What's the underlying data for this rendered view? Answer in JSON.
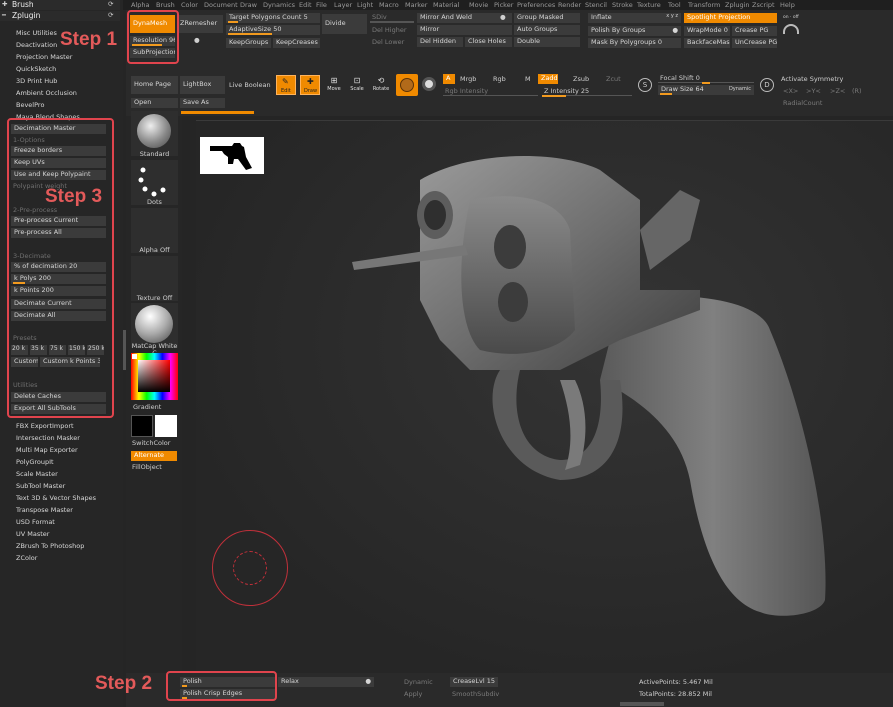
{
  "menu": [
    "Alpha",
    "Brush",
    "Color",
    "Document",
    "Draw",
    "Dynamics",
    "Edit",
    "File",
    "Layer",
    "Light",
    "Macro",
    "Marker",
    "Material",
    "Movie",
    "Picker",
    "Preferences",
    "Render",
    "Stencil",
    "Stroke",
    "Texture",
    "Tool",
    "Transform",
    "Zplugin",
    "Zscript",
    "Help"
  ],
  "left_panel": {
    "brush_title": "Brush",
    "zplugin_title": "Zplugin",
    "items_top": [
      "Misc Utilities",
      "Deactivation",
      "Projection Master",
      "QuickSketch",
      "3D Print Hub",
      "Ambient Occlusion",
      "BevelPro",
      "Maya Blend Shapes"
    ],
    "decimation": {
      "title": "Decimation Master",
      "options_header": "1-Options",
      "freeze": "Freeze borders",
      "keep_uvs": "Keep UVs",
      "use_keep_polypaint": "Use and Keep Polypaint",
      "polypaint_weight": "Polypaint weight",
      "preprocess_header": "2-Pre-process",
      "preprocess_current": "Pre-process Current",
      "preprocess_all": "Pre-process All",
      "decimate_header": "3-Decimate",
      "pct_label": "% of decimation",
      "pct_value": "20",
      "kpolys_label": "k Polys",
      "kpolys_value": "200",
      "kpoints_label": "k Points",
      "kpoints_value": "200",
      "decimate_current": "Decimate Current",
      "decimate_all": "Decimate All",
      "presets_header": "Presets",
      "presets": [
        "20 k",
        "35 k",
        "75 k",
        "150 k",
        "250 k"
      ],
      "custom": "Custom",
      "custom_k_label": "Custom k Points",
      "custom_k_value": "30",
      "utilities_header": "Utilities",
      "delete_caches": "Delete Caches",
      "export_all": "Export All SubTools"
    },
    "items_bottom": [
      "FBX ExportImport",
      "Intersection Masker",
      "Multi Map Exporter",
      "PolyGroupIt",
      "Scale Master",
      "SubTool Master",
      "Text 3D & Vector Shapes",
      "Transpose Master",
      "USD Format",
      "UV Master",
      "ZBrush To Photoshop",
      "ZColor"
    ]
  },
  "top": {
    "dynamesh": "DynaMesh",
    "resolution_label": "Resolution",
    "resolution_value": "968",
    "subprojection_label": "SubProjection",
    "subprojection_value": "0",
    "zremesher": "ZRemesher",
    "target_polys_label": "Target Polygons Count",
    "target_polys_value": "5",
    "adaptive_label": "AdaptiveSize",
    "adaptive_value": "50",
    "keepgroups": "KeepGroups",
    "keepcreases": "KeepCreases",
    "divide": "Divide",
    "sdiv": "SDiv",
    "del_higher": "Del Higher",
    "del_lower": "Del Lower",
    "mirror_weld": "Mirror And Weld",
    "mirror": "Mirror",
    "del_hidden": "Del Hidden",
    "close_holes": "Close Holes",
    "group_masked": "Group Masked",
    "auto_groups": "Auto Groups",
    "double": "Double",
    "inflate": "Inflate",
    "xyz": "x y z",
    "polish_groups": "Polish By Groups",
    "mask_polygroups_label": "Mask By Polygroups",
    "mask_polygroups_value": "0",
    "spotlight": "Spotlight Projection",
    "wrapmode_label": "WrapMode",
    "wrapmode_value": "0",
    "crease_pg": "Crease PG",
    "backface": "BackfaceMask",
    "uncrease_pg": "UnCrease PG",
    "rot_label": "on · off"
  },
  "shelf": {
    "home": "Home Page",
    "lightbox": "LightBox",
    "live_boolean": "Live Boolean",
    "open": "Open",
    "save_as": "Save As",
    "edit": "Edit",
    "draw": "Draw",
    "move": "Move",
    "scale": "Scale",
    "rotate": "Rotate",
    "a": "A",
    "mrgb": "Mrgb",
    "rgb": "Rgb",
    "m": "M",
    "rgb_intensity": "Rgb Intensity",
    "zadd": "Zadd",
    "zsub": "Zsub",
    "zcut": "Zcut",
    "z_intensity_label": "Z Intensity",
    "z_intensity_value": "25",
    "focal_label": "Focal Shift",
    "focal_value": "0",
    "drawsize_label": "Draw Size",
    "drawsize_value": "64",
    "dynamic": "Dynamic",
    "s_letter": "S",
    "d_letter": "D",
    "activate_symmetry": "Activate Symmetry",
    "sym_x": "<X>",
    "sym_y": ">Y<",
    "sym_z": ">Z<",
    "sym_r": "(R)",
    "radial_count": "RadialCount"
  },
  "left_tray": {
    "standard": "Standard",
    "dots": "Dots",
    "alpha_off": "Alpha Off",
    "texture_off": "Texture Off",
    "matcap": "MatCap White C",
    "gradient": "Gradient",
    "switch_color": "SwitchColor",
    "alternate": "Alternate",
    "fill_object": "FillObject"
  },
  "bottom": {
    "polish": "Polish",
    "polish_crisp": "Polish Crisp Edges",
    "relax": "Relax",
    "dynamic": "Dynamic",
    "apply": "Apply",
    "creaselvl_label": "CreaseLvl",
    "creaselvl_value": "15",
    "smoothsubdiv": "SmoothSubdiv",
    "active_points": "ActivePoints: 5.467 Mil",
    "total_points": "TotalPoints: 28.852 Mil"
  },
  "steps": {
    "step1": "Step 1",
    "step2": "Step 2",
    "step3": "Step 3"
  },
  "colors": {
    "accent": "#f08a00",
    "annotation": "#e0444d",
    "background": "#252525",
    "canvas": "#2a2a2a"
  }
}
